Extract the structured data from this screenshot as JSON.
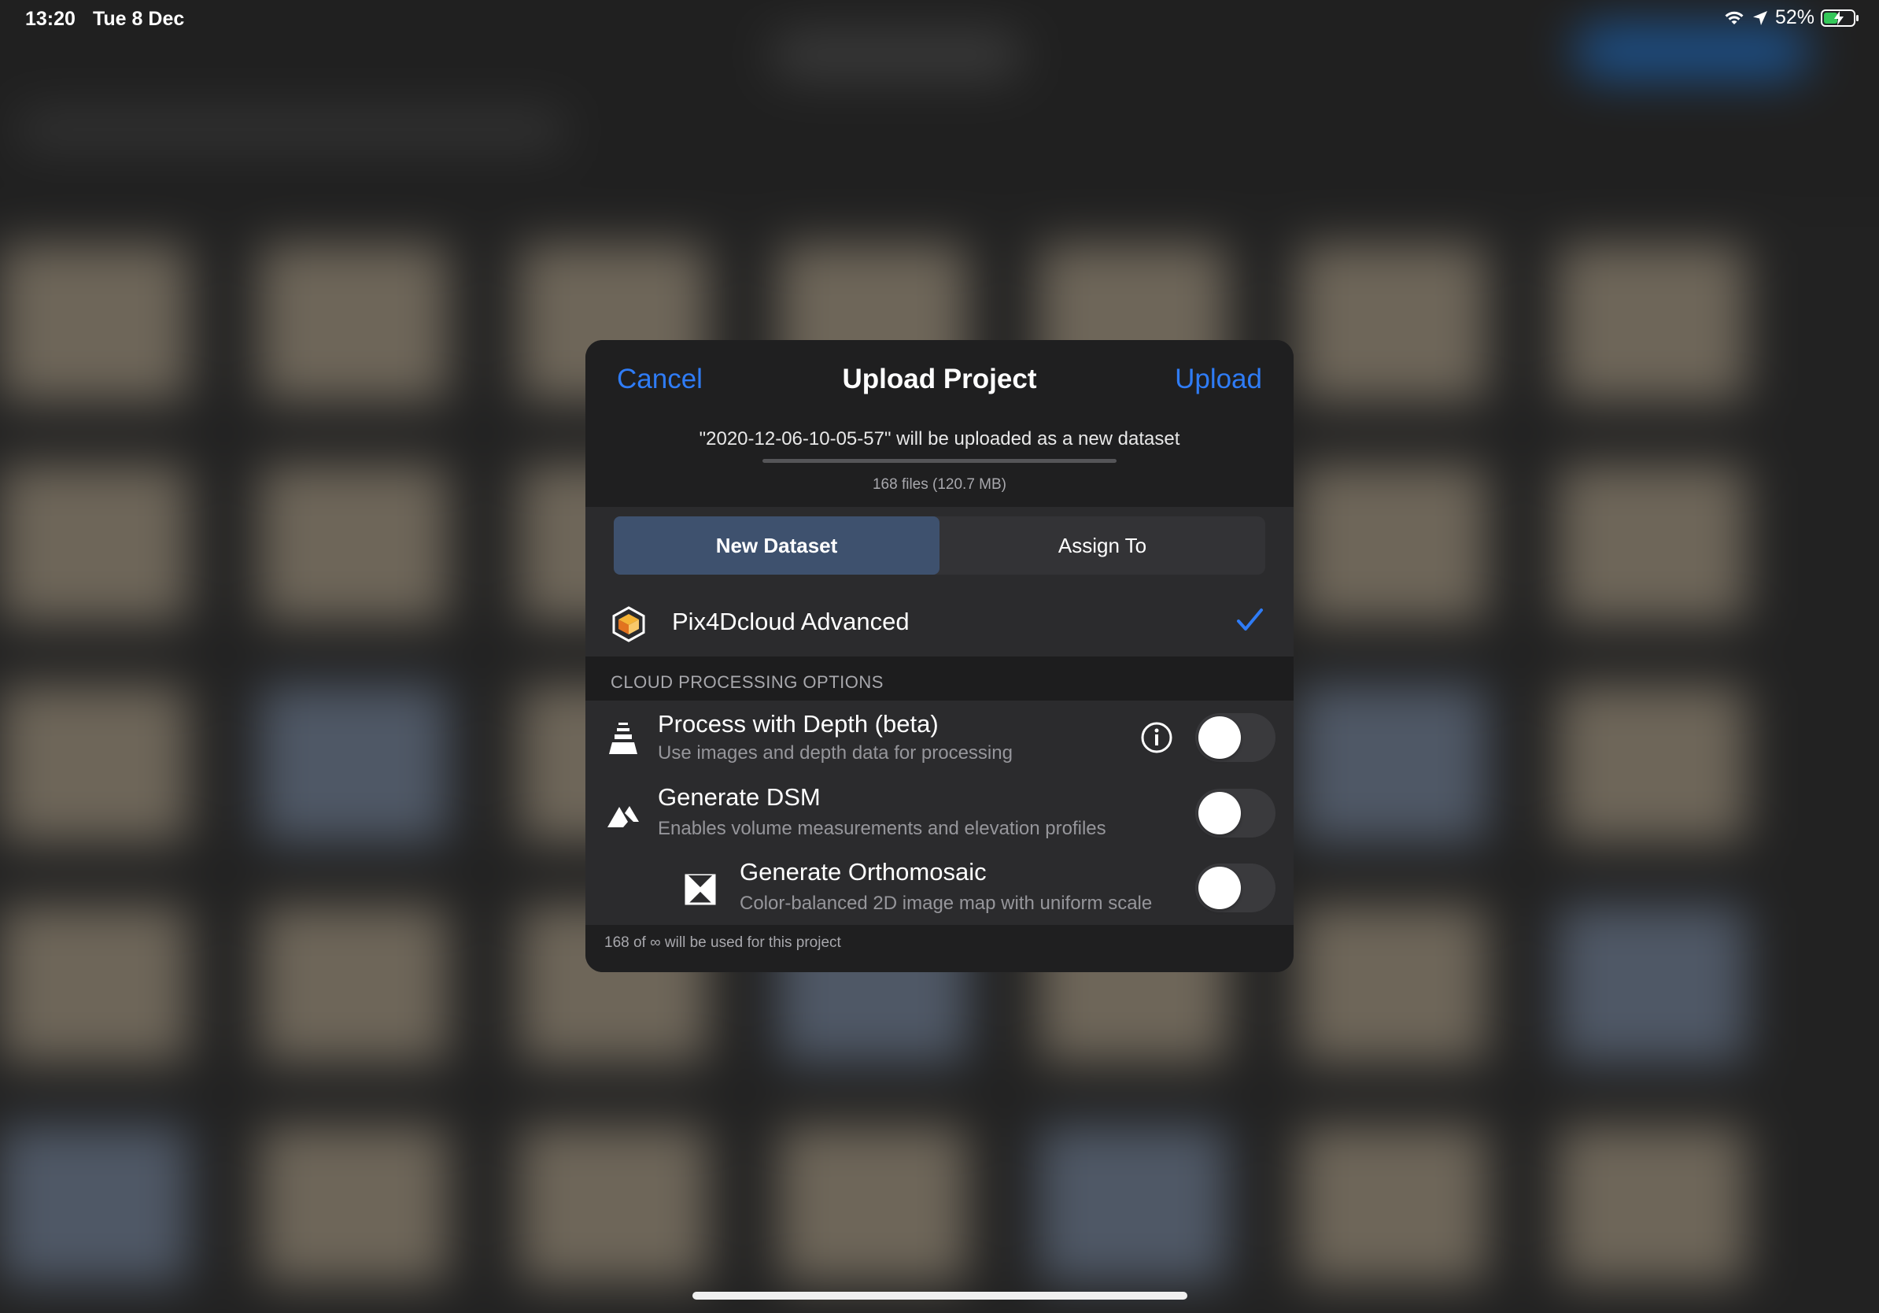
{
  "status_bar": {
    "time": "13:20",
    "date": "Tue 8 Dec",
    "battery": "52%",
    "battery_level": 0.52,
    "icons": [
      "wifi-icon",
      "location-arrow-icon",
      "battery-charging-icon"
    ]
  },
  "dialog": {
    "cancel_label": "Cancel",
    "title": "Upload Project",
    "upload_label": "Upload",
    "subtitle": "\"2020-12-06-10-05-57\" will be uploaded as a new dataset",
    "upload_progress": 0,
    "file_info": "168 files (120.7 MB)",
    "segments": [
      "New Dataset",
      "Assign To"
    ],
    "selected_segment": "New Dataset",
    "product": {
      "label": "Pix4Dcloud Advanced",
      "selected": true,
      "icon": "pix4dcloud-logo-icon"
    },
    "section_header": "CLOUD PROCESSING OPTIONS",
    "options": [
      {
        "title": "Process with Depth (beta)",
        "subtitle": "Use images and depth data for processing",
        "icon": "depth-layers-icon",
        "has_info": true,
        "enabled": false
      },
      {
        "title": "Generate DSM",
        "subtitle": "Enables volume measurements and elevation profiles",
        "icon": "mountain-icon",
        "has_info": false,
        "enabled": false
      },
      {
        "title": "Generate Orthomosaic",
        "subtitle": "Color-balanced 2D image map with uniform scale",
        "icon": "orthomosaic-icon",
        "has_info": false,
        "enabled": false
      }
    ],
    "footer_note": "168 of ∞ will be used for this project"
  },
  "colors": {
    "accent": "#2f7cf6",
    "segment_active": "#3e516e",
    "battery_fill": "#34c759"
  }
}
